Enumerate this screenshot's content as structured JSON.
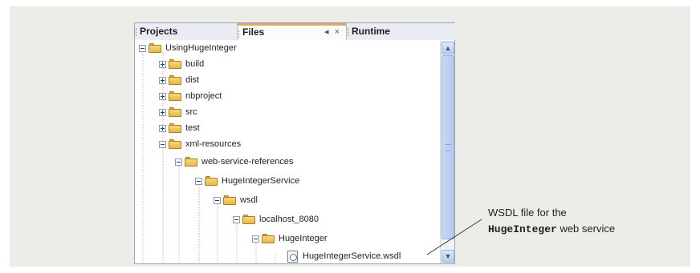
{
  "tabs": {
    "projects": "Projects",
    "files": "Files",
    "files_pin": "◂",
    "files_close": "×",
    "runtime": "Runtime"
  },
  "tree": {
    "root": "UsingHugeInteger",
    "build": "build",
    "dist": "dist",
    "nbproject": "nbproject",
    "src": "src",
    "test": "test",
    "xml_resources": "xml-resources",
    "web_service_references": "web-service-references",
    "huge_integer_service": "HugeIntegerService",
    "wsdl": "wsdl",
    "localhost": "localhost_8080",
    "huge_integer": "HugeInteger",
    "wsdl_file": "HugeIntegerService.wsdl"
  },
  "scrollbar": {
    "up": "▲",
    "down": "▼"
  },
  "callout": {
    "line1": "WSDL file for the",
    "code": "HugeInteger",
    "line2_rest": " web service"
  }
}
